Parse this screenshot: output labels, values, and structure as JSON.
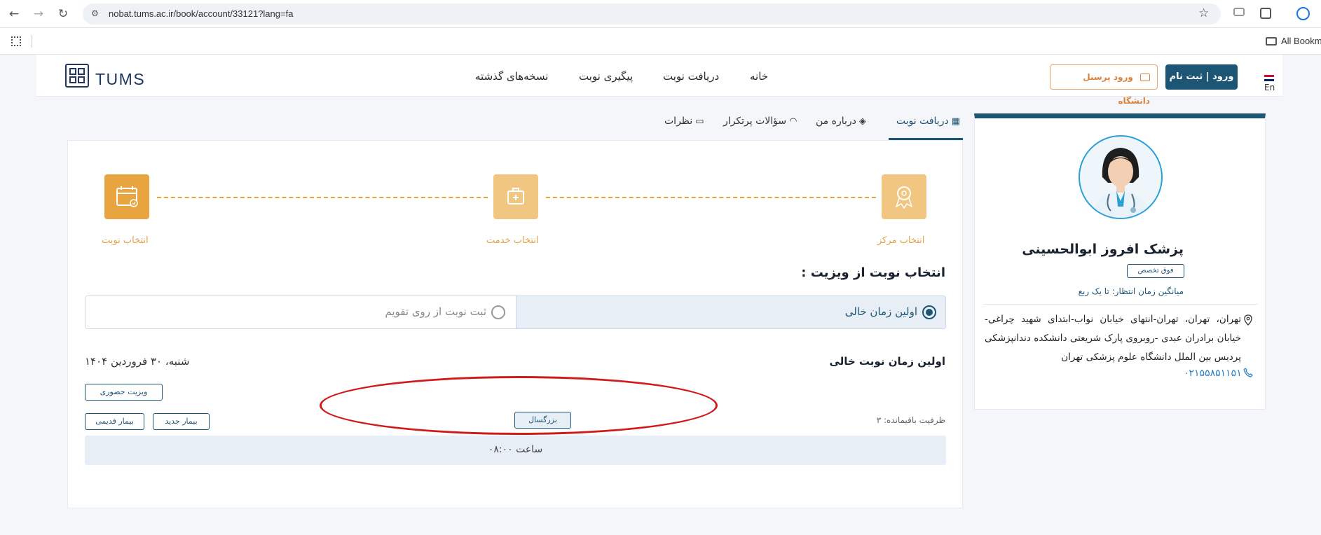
{
  "browser": {
    "url": "nobat.tums.ac.ir/book/account/33121?lang=fa",
    "bookmarks_label": "All Bookma"
  },
  "header": {
    "logo_text": "TUMS",
    "nav": [
      "خانه",
      "دریافت نوبت",
      "پیگیری نوبت",
      "نسخه‌های گذشته"
    ],
    "login_label": "ورود | ثبت نام",
    "staff_label": "ورود پرسنل دانشگاه",
    "lang_label": "En"
  },
  "tabs": [
    "دریافت نوبت",
    "درباره من",
    "سؤالات پرتکرار",
    "نظرات"
  ],
  "steps": [
    "انتخاب مرکز",
    "انتخاب خدمت",
    "انتخاب نوبت"
  ],
  "booking": {
    "section_title": "انتخاب نوبت از ویزیت :",
    "option_first": "اولین زمان خالی",
    "option_calendar": "ثبت نوبت از روی تقویم",
    "subtitle": "اولین زمان نوبت خالی",
    "date": "شنبه، ۳۰ فروردین ۱۴۰۴",
    "visit_type": "ویزیت حضوری",
    "capacity": "ظرفیت باقیمانده: ۳",
    "age_group": "بزرگسال",
    "patient_new": "بیمار جدید",
    "patient_old": "بیمار قدیمی",
    "slot": "ساعت ۰۸:۰۰"
  },
  "doctor": {
    "name": "پزشک افروز ابوالحسینی",
    "specialty": "فوق تخصص",
    "wait_time": "میانگین زمان انتظار: تا یک ربع",
    "address": "تهران، تهران، تهران-انتهای خیابان نواب-ابتدای شهید چراغی-خیابان برادران عبدی -روبروی پارک شریعتی دانشکده دندانپزشکی پردیس بین الملل دانشگاه علوم پزشکی تهران",
    "phone": "۰۲۱۵۵۸۵۱۱۵۱"
  },
  "colors": {
    "primary": "#1d5574",
    "accent_orange": "#e8a53f",
    "annotation_red": "#d11a1a"
  }
}
